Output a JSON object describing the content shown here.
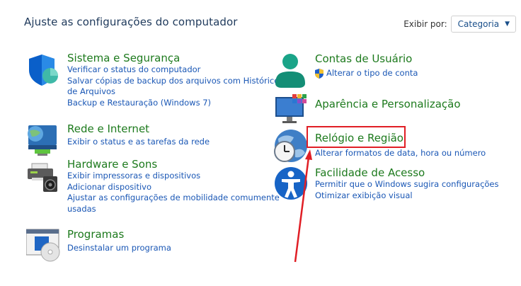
{
  "header": {
    "title": "Ajuste as configurações do computador",
    "view_by_label": "Exibir por:",
    "view_by_value": "Categoria"
  },
  "categories": {
    "system_security": {
      "title": "Sistema e Segurança",
      "links": [
        "Verificar o status do computador",
        "Salvar cópias de backup dos arquivos com Histórico",
        "de Arquivos",
        "Backup e Restauração (Windows 7)"
      ]
    },
    "network": {
      "title": "Rede e Internet",
      "links": [
        "Exibir o status e as tarefas da rede"
      ]
    },
    "hardware": {
      "title": "Hardware e Sons",
      "links": [
        "Exibir impressoras e dispositivos",
        "Adicionar dispositivo",
        "Ajustar as configurações de mobilidade comumente",
        "usadas"
      ]
    },
    "programs": {
      "title": "Programas",
      "links": [
        "Desinstalar um programa"
      ]
    },
    "user_accounts": {
      "title": "Contas de Usuário",
      "links": [
        "Alterar o tipo de conta"
      ]
    },
    "appearance": {
      "title": "Aparência e Personalização",
      "links": []
    },
    "clock_region": {
      "title": "Relógio e Região",
      "links": [
        "Alterar formatos de data, hora ou número"
      ]
    },
    "ease_access": {
      "title": "Facilidade de Acesso",
      "links": [
        "Permitir que o Windows sugira configurações",
        "Otimizar exibição visual"
      ]
    }
  },
  "colors": {
    "category_title": "#1d7a1d",
    "link": "#1a57b5",
    "annotation": "#e01e25"
  },
  "icons": {
    "system_security": "shield-icon",
    "network": "globe-network-icon",
    "hardware": "printer-speaker-icon",
    "programs": "programs-disc-icon",
    "user_accounts": "user-icon",
    "appearance": "monitor-palette-icon",
    "clock_region": "globe-clock-icon",
    "ease_access": "accessibility-icon",
    "uac": "uac-shield-icon"
  }
}
